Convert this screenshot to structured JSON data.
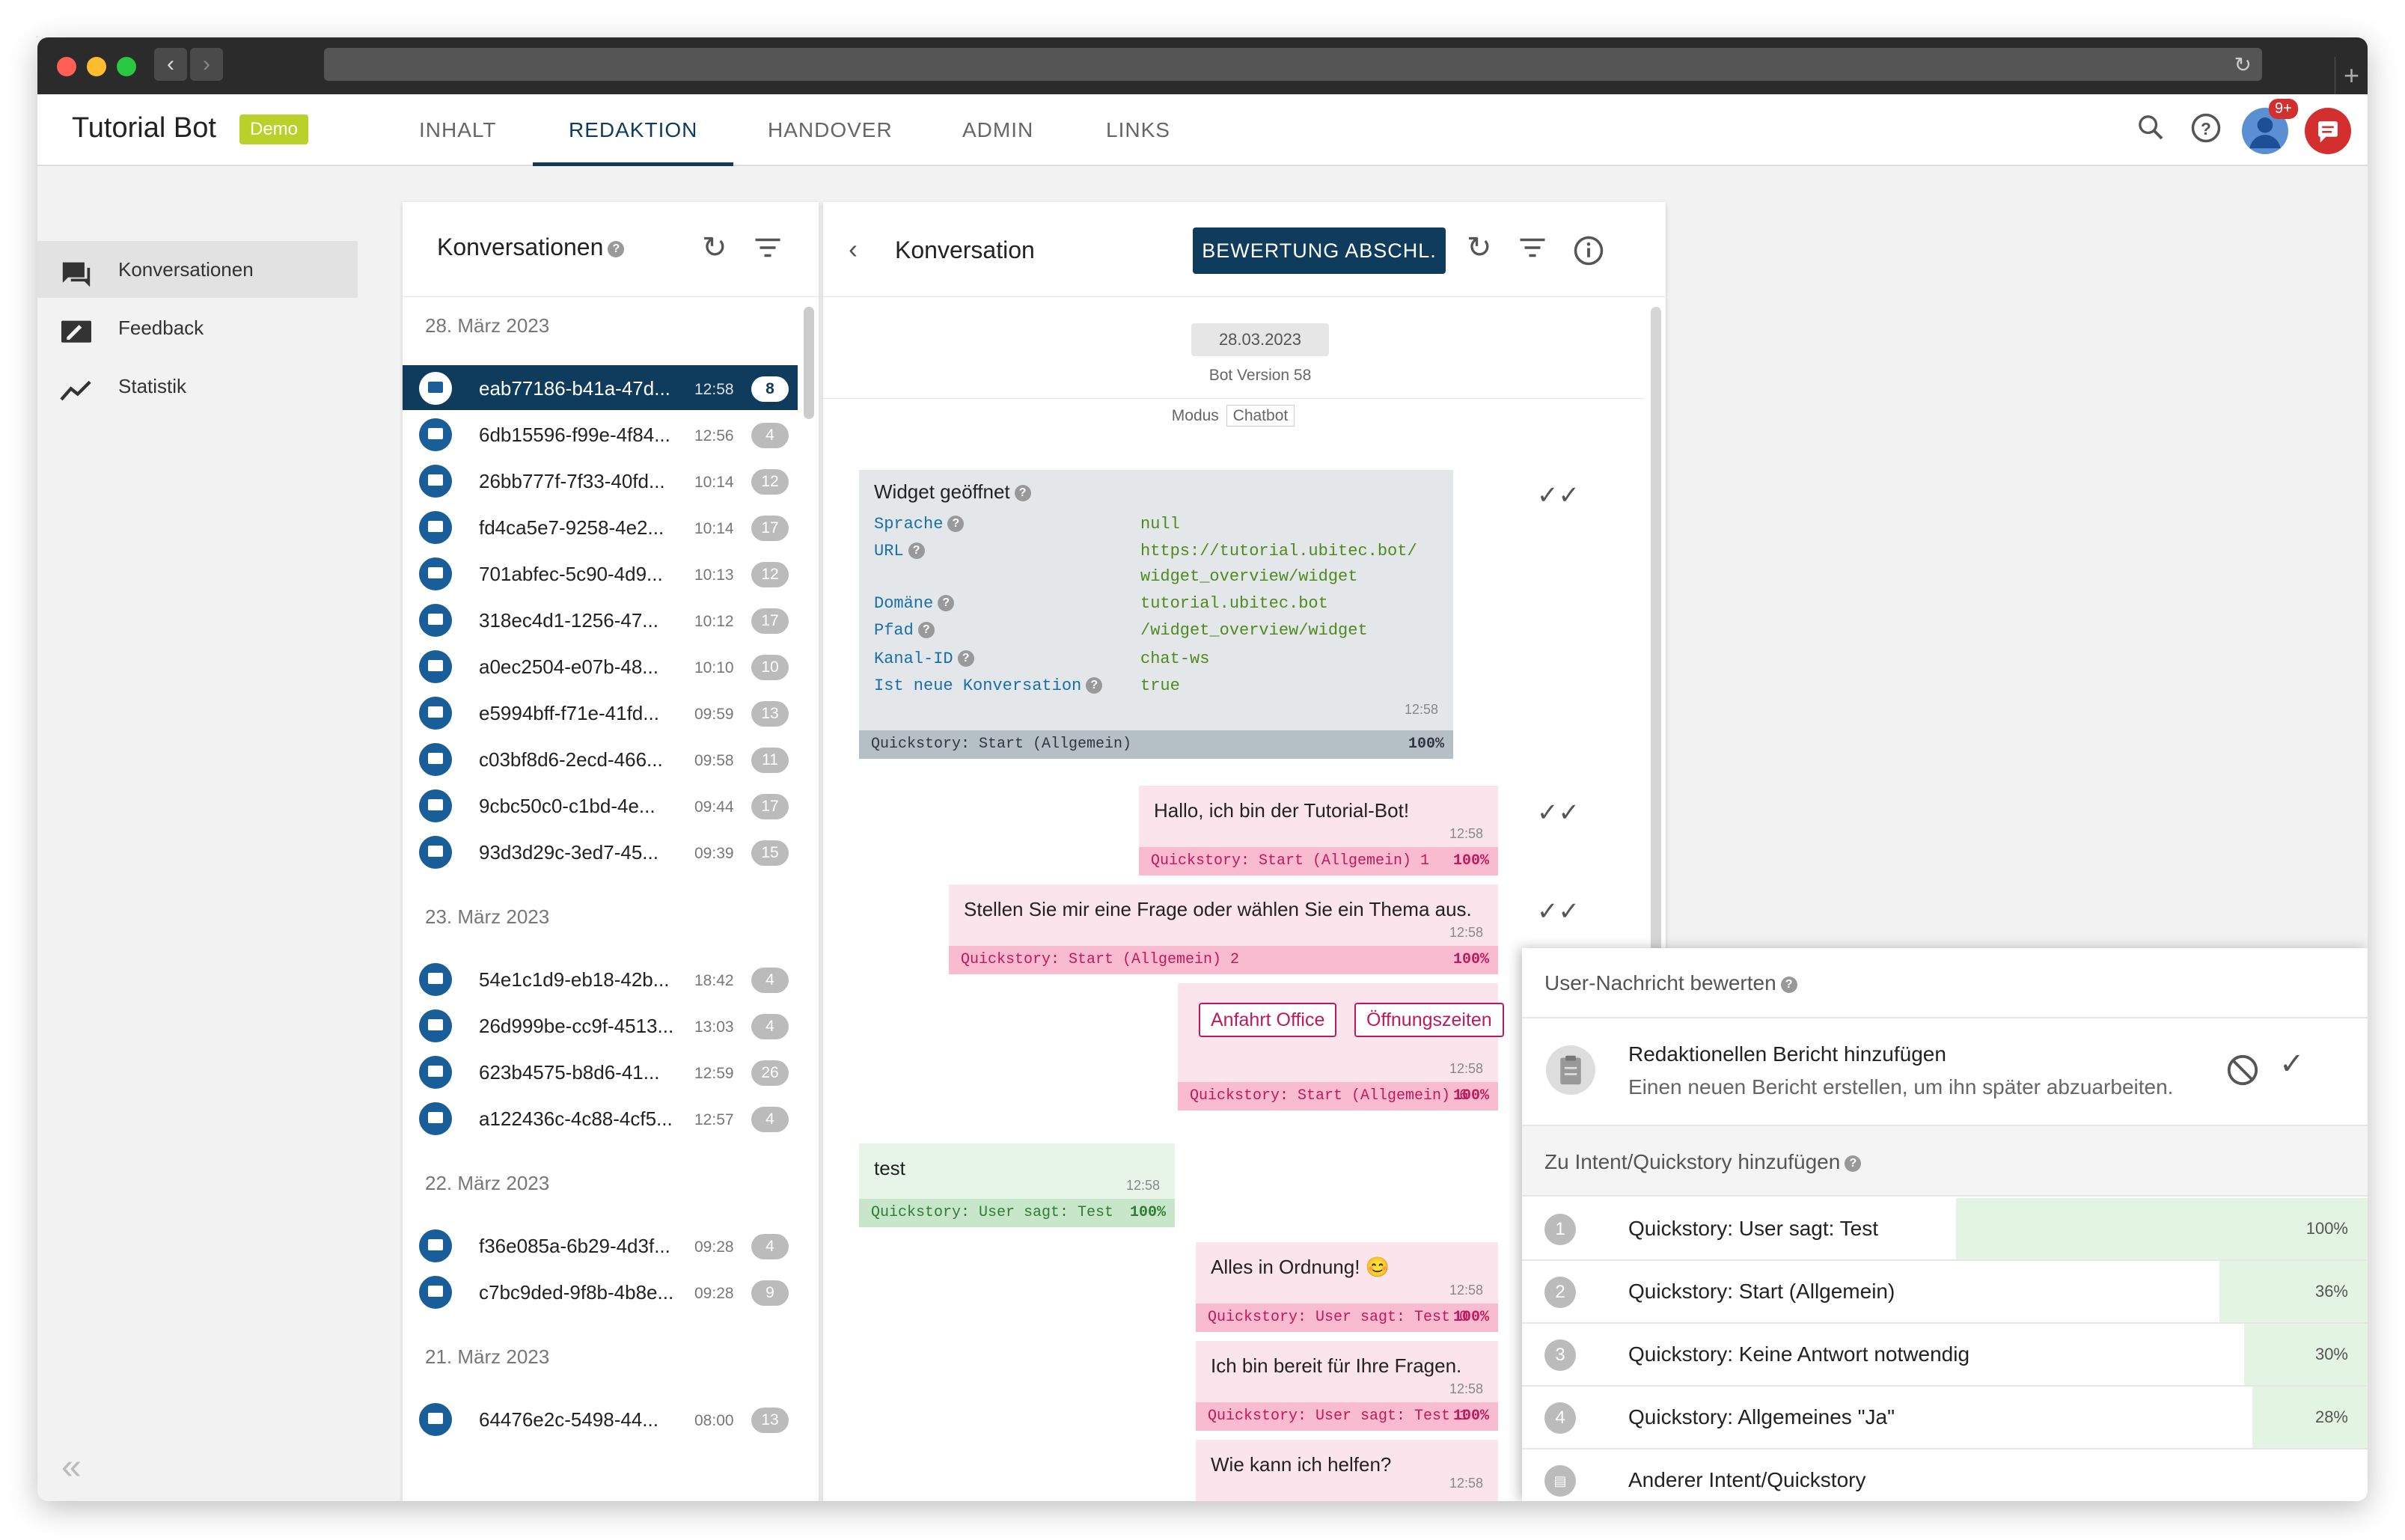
{
  "header": {
    "brand": "Tutorial Bot",
    "badge": "Demo",
    "tabs": [
      "INHALT",
      "REDAKTION",
      "HANDOVER",
      "ADMIN",
      "LINKS"
    ],
    "active_tab": "REDAKTION",
    "notification_badge": "9+"
  },
  "sidebar": {
    "items": [
      {
        "label": "Konversationen",
        "icon": "chat-icon"
      },
      {
        "label": "Feedback",
        "icon": "edit-feedback-icon"
      },
      {
        "label": "Statistik",
        "icon": "trending-icon"
      }
    ]
  },
  "conversations": {
    "title": "Konversationen",
    "groups": [
      {
        "date": "28. März 2023",
        "items": [
          {
            "id": "eab77186-b41a-47d...",
            "time": "12:58",
            "count": "8"
          },
          {
            "id": "6db15596-f99e-4f84...",
            "time": "12:56",
            "count": "4"
          },
          {
            "id": "26bb777f-7f33-40fd...",
            "time": "10:14",
            "count": "12"
          },
          {
            "id": "fd4ca5e7-9258-4e2...",
            "time": "10:14",
            "count": "17"
          },
          {
            "id": "701abfec-5c90-4d9...",
            "time": "10:13",
            "count": "12"
          },
          {
            "id": "318ec4d1-1256-47...",
            "time": "10:12",
            "count": "17"
          },
          {
            "id": "a0ec2504-e07b-48...",
            "time": "10:10",
            "count": "10"
          },
          {
            "id": "e5994bff-f71e-41fd...",
            "time": "09:59",
            "count": "13"
          },
          {
            "id": "c03bf8d6-2ecd-466...",
            "time": "09:58",
            "count": "11"
          },
          {
            "id": "9cbc50c0-c1bd-4e...",
            "time": "09:44",
            "count": "17"
          },
          {
            "id": "93d3d29c-3ed7-45...",
            "time": "09:39",
            "count": "15"
          }
        ]
      },
      {
        "date": "23. März 2023",
        "items": [
          {
            "id": "54e1c1d9-eb18-42b...",
            "time": "18:42",
            "count": "4"
          },
          {
            "id": "26d999be-cc9f-4513...",
            "time": "13:03",
            "count": "4"
          },
          {
            "id": "623b4575-b8d6-41...",
            "time": "12:59",
            "count": "26"
          },
          {
            "id": "a122436c-4c88-4cf5...",
            "time": "12:57",
            "count": "4"
          }
        ]
      },
      {
        "date": "22. März 2023",
        "items": [
          {
            "id": "f36e085a-6b29-4d3f...",
            "time": "09:28",
            "count": "4"
          },
          {
            "id": "c7bc9ded-9f8b-4b8e...",
            "time": "09:28",
            "count": "9"
          }
        ]
      },
      {
        "date": "21. März 2023",
        "items": [
          {
            "id": "64476e2c-5498-44...",
            "time": "08:00",
            "count": "13"
          }
        ]
      }
    ]
  },
  "conversation": {
    "title": "Konversation",
    "action_button": "BEWERTUNG ABSCHL.",
    "date_pill": "28.03.2023",
    "bot_version": "Bot Version 58",
    "modus_label": "Modus",
    "modus_value": "Chatbot",
    "widget": {
      "title": "Widget geöffnet",
      "fields": [
        {
          "key": "Sprache",
          "value": "null"
        },
        {
          "key": "URL",
          "value": "https://tutorial.ubitec.bot/",
          "value2": "widget_overview/widget"
        },
        {
          "key": "Domäne",
          "value": "tutorial.ubitec.bot"
        },
        {
          "key": "Pfad",
          "value": "/widget_overview/widget"
        },
        {
          "key": "Kanal-ID",
          "value": "chat-ws"
        },
        {
          "key": "Ist neue Konversation",
          "value": "true"
        }
      ],
      "time": "12:58",
      "footer": "Quickstory: Start (Allgemein)",
      "pct": "100%"
    },
    "messages": [
      {
        "text": "Hallo, ich bin der Tutorial-Bot!",
        "time": "12:58",
        "footer": "Quickstory: Start (Allgemein) 1",
        "pct": "100%"
      },
      {
        "text": "Stellen Sie mir eine Frage oder wählen Sie ein Thema aus.",
        "time": "12:58",
        "footer": "Quickstory: Start (Allgemein) 2",
        "pct": "100%"
      },
      {
        "buttons": [
          "Anfahrt Office",
          "Öffnungszeiten"
        ],
        "time": "12:58",
        "footer": "Quickstory: Start (Allgemein) 6",
        "pct": "100%"
      },
      {
        "text": "test",
        "time": "12:58",
        "footer": "Quickstory: User sagt: Test",
        "pct": "100%"
      },
      {
        "text": "Alles in Ordnung! 😊",
        "time": "12:58",
        "footer": "Quickstory: User sagt: Test 0",
        "pct": "100%"
      },
      {
        "text": "Ich bin bereit für Ihre Fragen.",
        "time": "12:58",
        "footer": "Quickstory: User sagt: Test 1",
        "pct": "100%"
      },
      {
        "text": "Wie kann ich helfen?",
        "time": "12:58"
      }
    ]
  },
  "rating": {
    "title": "User-Nachricht bewerten",
    "report_title": "Redaktionellen Bericht hinzufügen",
    "report_subtitle": "Einen neuen Bericht erstellen, um ihn später abzuarbeiten.",
    "intent_section": "Zu Intent/Quickstory hinzufügen",
    "intents": [
      {
        "num": "1",
        "label": "Quickstory: User sagt: Test",
        "pct": "100%",
        "score": 1.0
      },
      {
        "num": "2",
        "label": "Quickstory: Start (Allgemein)",
        "pct": "36%",
        "score": 0.36
      },
      {
        "num": "3",
        "label": "Quickstory: Keine Antwort notwendig",
        "pct": "30%",
        "score": 0.3
      },
      {
        "num": "4",
        "label": "Quickstory: Allgemeines \"Ja\"",
        "pct": "28%",
        "score": 0.28
      }
    ],
    "other_intent": "Anderer Intent/Quickstory"
  },
  "colors": {
    "primary": "#0f3c5c",
    "bot_bubble": "#fce4ec",
    "bot_footer": "#f8bbd0",
    "user_bubble": "#e8f5e9",
    "user_footer": "#c8e6c9",
    "demo_badge": "#b8d22a",
    "alert": "#d32f2f"
  }
}
